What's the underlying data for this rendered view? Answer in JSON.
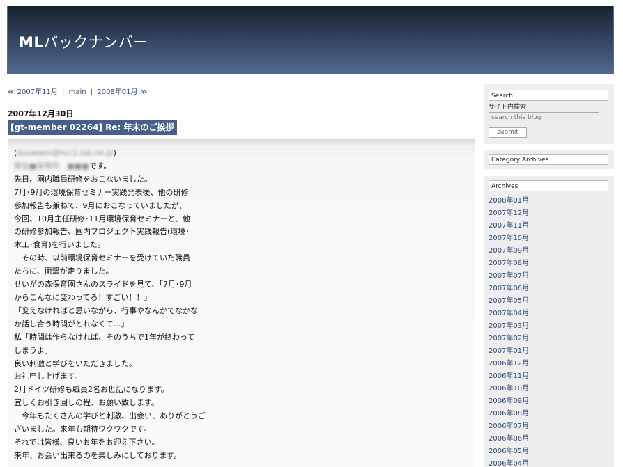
{
  "header": {
    "title_bold": "ML",
    "title_rest": "バックナンバー"
  },
  "nav": {
    "prev_arrow": "≪",
    "prev_label": "2007年11月",
    "separator": "|",
    "main_label": "main",
    "next_label": "2008年01月",
    "next_arrow": "≫"
  },
  "entry": {
    "date": "2007年12月30日",
    "title": "[gt-member 02264] Re: 年末のご挨拶",
    "lines": [
      "(",
      "です。",
      "先日、園内職員研修をおこないました。",
      "7月･9月の環境保育セミナー実践発表後、他の研修",
      "参加報告も兼ねて、9月におこなっていましたが、",
      "今回、10月主任研修･11月環境保育セミナーと、他",
      "の研修参加報告、園内プロジェクト実践報告(環境･",
      "木工･食育)を行いました。",
      "　その時、以前環境保育セミナーを受けていた職員",
      "たちに、衝撃が走りました。",
      "せいがの森保育園さんのスライドを見て、「7月･9月",
      "からこんなに変わってる！すごい！！」",
      "「変えなければと思いながら、行事やなんかでなかな",
      "か話し合う時間がとれなくて…」",
      "私「時間は作らなければ、そのうちで1年が終わって",
      "しまうよ」",
      "良い刺激と学びをいただきました。",
      "お礼申し上げます。",
      "2月ドイツ研修も職員2名お世話になります。",
      "宜しくお引き回しの程、お願い致します。",
      "　今年もたくさんの学びと刺激、出会い、ありがとうご",
      "ざいました。来年も期待ワクワクです。",
      "それでは皆様、良いお年をお迎え下さい。",
      "来年、お会い出来るのを楽しみにしております。"
    ],
    "redacted_email": "bouwaen@hcc1.bai.ne.jp",
    "redacted_name": "東伯■保育所　■■■"
  },
  "sidebar": {
    "search": {
      "label": "Search",
      "sub_label": "サイト内検索",
      "placeholder": "search this blog",
      "submit_label": "submit"
    },
    "category": {
      "label": "Category Archives"
    },
    "archives": {
      "label": "Archives",
      "items": [
        "2008年01月",
        "2007年12月",
        "2007年11月",
        "2007年10月",
        "2007年09月",
        "2007年08月",
        "2007年07月",
        "2007年06月",
        "2007年05月",
        "2007年04月",
        "2007年03月",
        "2007年02月",
        "2007年01月",
        "2006年12月",
        "2006年11月",
        "2006年10月",
        "2006年09月",
        "2006年08月",
        "2006年07月",
        "2006年06月",
        "2006年05月",
        "2006年04月"
      ]
    }
  },
  "colors": {
    "header_dark": "#1a2230",
    "header_light": "#51698f",
    "title_bar": "#46608a",
    "link": "#334d7a"
  }
}
